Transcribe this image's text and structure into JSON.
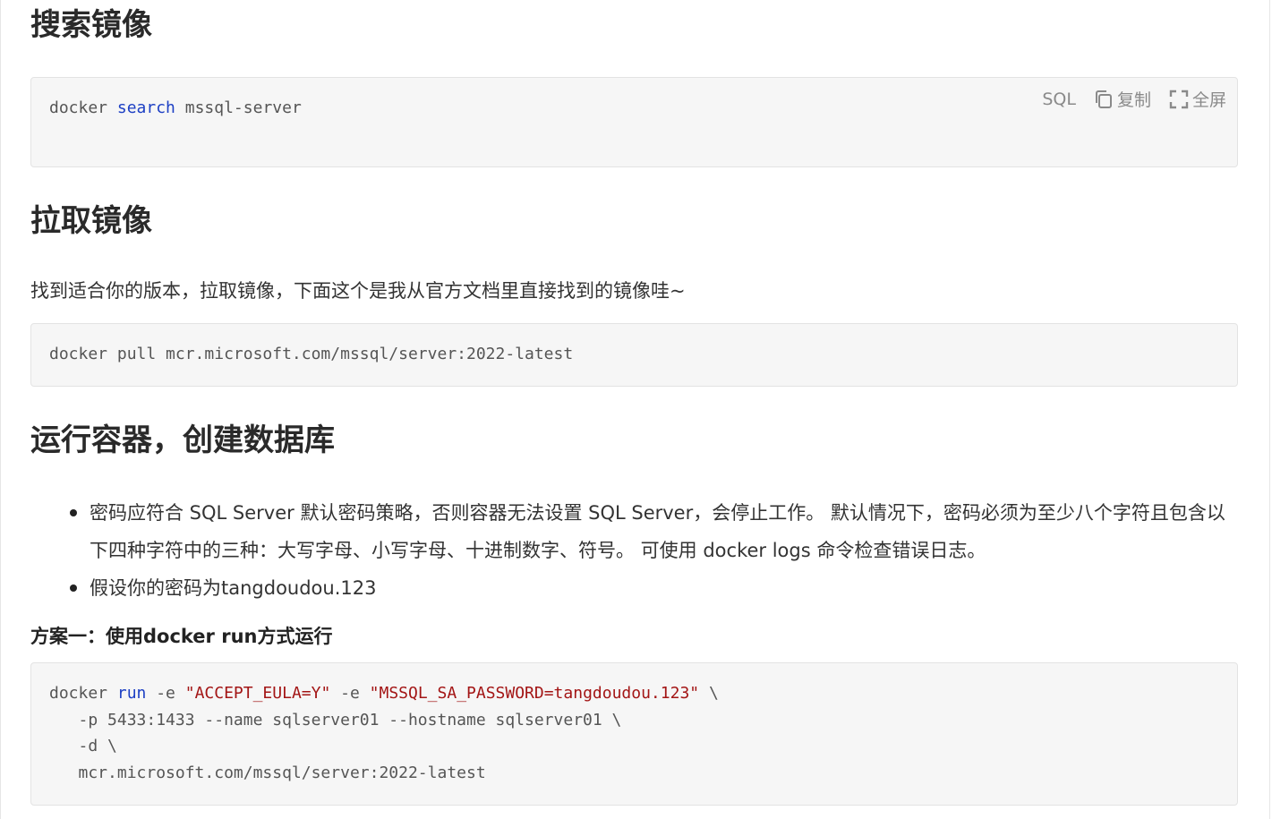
{
  "section_search": {
    "heading": "搜索镜像",
    "code_lang": "SQL",
    "copy_label": "复制",
    "fullscreen_label": "全屏",
    "code": {
      "cmd": "docker",
      "kw": "search",
      "arg": "mssql-server"
    }
  },
  "section_pull": {
    "heading": "拉取镜像",
    "paragraph": "找到适合你的版本，拉取镜像，下面这个是我从官方文档里直接找到的镜像哇~",
    "code": "docker pull mcr.microsoft.com/mssql/server:2022-latest"
  },
  "section_run": {
    "heading": "运行容器，创建数据库",
    "bullets": [
      "密码应符合 SQL Server 默认密码策略，否则容器无法设置 SQL Server，会停止工作。 默认情况下，密码必须为至少八个字符且包含以下四种字符中的三种：大写字母、小写字母、十进制数字、符号。 可使用 docker logs 命令检查错误日志。",
      "假设你的密码为tangdoudou.123"
    ],
    "subheading": "方案一：使用docker run方式运行",
    "code": {
      "l1_cmd": "docker ",
      "l1_kw": "run",
      "l1_a": " -e ",
      "l1_s1": "\"ACCEPT_EULA=Y\"",
      "l1_b": " -e ",
      "l1_s2": "\"MSSQL_SA_PASSWORD=tangdoudou.123\"",
      "l1_c": " \\",
      "l2": "   -p 5433:1433 --name sqlserver01 --hostname sqlserver01 \\",
      "l3": "   -d \\",
      "l4": "   mcr.microsoft.com/mssql/server:2022-latest"
    }
  }
}
